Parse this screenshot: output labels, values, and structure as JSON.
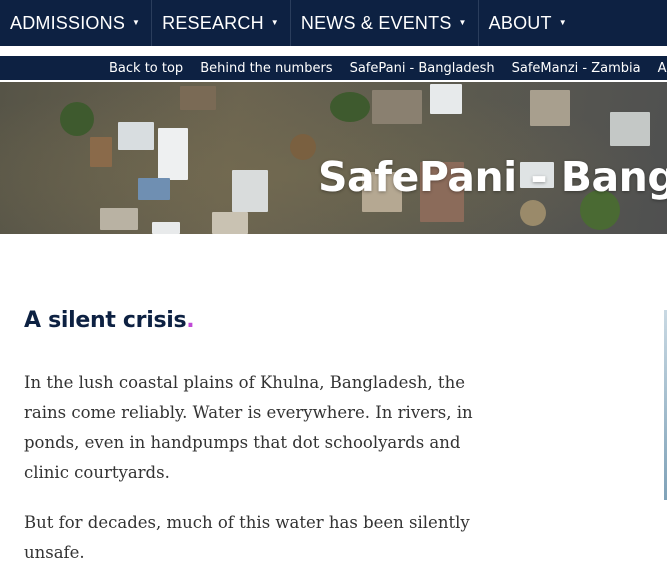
{
  "top_nav": {
    "items": [
      {
        "label": "ADMISSIONS"
      },
      {
        "label": "RESEARCH"
      },
      {
        "label": "NEWS & EVENTS"
      },
      {
        "label": "ABOUT"
      }
    ],
    "caret_glyph": "▼"
  },
  "sub_nav": {
    "links": [
      {
        "label": "Back to top"
      },
      {
        "label": "Behind the numbers"
      },
      {
        "label": "SafePani - Bangladesh"
      },
      {
        "label": "SafeManzi - Zambia"
      },
      {
        "label": "A global R"
      }
    ]
  },
  "hero": {
    "title": "SafePani - Bangladesh",
    "image_icon": "aerial-flood-village-image"
  },
  "article": {
    "heading": "A silent crisis",
    "heading_dot": ".",
    "paragraph_1": "In the lush coastal plains of Khulna, Bangladesh, the rains come reliably. Water is everywhere. In rivers, in ponds, even in handpumps that dot schoolyards and clinic courtyards.",
    "paragraph_2": "But for decades, much of this water has been silently unsafe."
  },
  "colors": {
    "nav_bg": "#0d2142",
    "heading": "#0d2142",
    "accent_dot": "#c04ad6",
    "body_text": "#333333"
  }
}
